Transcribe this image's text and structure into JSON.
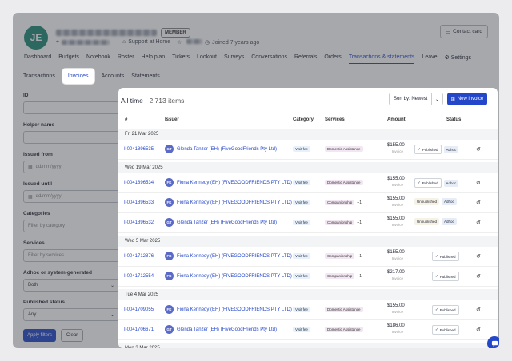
{
  "profile": {
    "initials": "JE",
    "member_badge": "MEMBER",
    "meta_support": "Support at Home",
    "meta_joined": "Joined 7 years ago",
    "contact_label": "Contact card"
  },
  "nav": [
    "Dashboard",
    "Budgets",
    "Notebook",
    "Roster",
    "Help plan",
    "Tickets",
    "Lookout",
    "Surveys",
    "Conversations",
    "Referrals",
    "Orders",
    "Transactions & statements",
    "Leave",
    "Settings"
  ],
  "subtabs": [
    "Transactions",
    "Invoices",
    "Accounts",
    "Statements"
  ],
  "filters": {
    "id_label": "ID",
    "helper_label": "Helper name",
    "issued_from_label": "Issued from",
    "issued_from_placeholder": "dd/mm/yyyy",
    "issued_until_label": "Issued until",
    "issued_until_placeholder": "dd/mm/yyyy",
    "categories_label": "Categories",
    "categories_placeholder": "Filter by category",
    "services_label": "Services",
    "services_placeholder": "Filter by services",
    "adhoc_label": "Adhoc or system-generated",
    "adhoc_value": "Both",
    "published_label": "Published status",
    "published_value": "Any",
    "apply_label": "Apply filters",
    "clear_label": "Clear"
  },
  "invoices": {
    "title": "All time",
    "count": "2,713 items",
    "sort_label": "Sort by: Newest",
    "new_label": "New invoice",
    "columns": [
      "#",
      "Issuer",
      "Category",
      "Services",
      "Amount",
      "Status"
    ],
    "groups": [
      {
        "date": "Fri 21 Mar 2025",
        "rows": [
          {
            "id": "I-0041896535",
            "initials": "GT",
            "issuer": "Glenda Tanzer (EH) (FiveGoodFriends Pty Ltd)",
            "category": "Visit fee",
            "service": "Domestic Assistance",
            "more": "",
            "amount": "$155.00",
            "amount_sub": "Invoice",
            "status": "Published",
            "adhoc": "Adhoc"
          }
        ]
      },
      {
        "date": "Wed 19 Mar 2025",
        "rows": [
          {
            "id": "I-0041896534",
            "initials": "FK",
            "issuer": "Fiona Kennedy (EH) (FIVEGOODFRIENDS PTY LTD)",
            "category": "Visit fee",
            "service": "Domestic Assistance",
            "more": "",
            "amount": "$155.00",
            "amount_sub": "Invoice",
            "status": "Published",
            "adhoc": "Adhoc"
          },
          {
            "id": "I-0041896533",
            "initials": "FK",
            "issuer": "Fiona Kennedy (EH) (FIVEGOODFRIENDS PTY LTD)",
            "category": "Visit fee",
            "service": "Companionship",
            "more": "+1",
            "amount": "$155.00",
            "amount_sub": "Invoice",
            "status": "Unpublished",
            "adhoc": "Adhoc"
          },
          {
            "id": "I-0041896532",
            "initials": "GT",
            "issuer": "Glenda Tanzer (EH) (FiveGoodFriends Pty Ltd)",
            "category": "Visit fee",
            "service": "Companionship",
            "more": "+1",
            "amount": "$155.00",
            "amount_sub": "Invoice",
            "status": "Unpublished",
            "adhoc": "Adhoc"
          }
        ]
      },
      {
        "date": "Wed 5 Mar 2025",
        "rows": [
          {
            "id": "I-0041712876",
            "initials": "FK",
            "issuer": "Fiona Kennedy (EH) (FIVEGOODFRIENDS PTY LTD)",
            "category": "Visit fee",
            "service": "Companionship",
            "more": "+1",
            "amount": "$155.00",
            "amount_sub": "Invoice",
            "status": "Published",
            "adhoc": ""
          },
          {
            "id": "I-0041712554",
            "initials": "FK",
            "issuer": "Fiona Kennedy (EH) (FIVEGOODFRIENDS PTY LTD)",
            "category": "Visit fee",
            "service": "Companionship",
            "more": "+1",
            "amount": "$217.00",
            "amount_sub": "Invoice",
            "status": "Published",
            "adhoc": ""
          }
        ]
      },
      {
        "date": "Tue 4 Mar 2025",
        "rows": [
          {
            "id": "I-0041709055",
            "initials": "FK",
            "issuer": "Fiona Kennedy (EH) (FIVEGOODFRIENDS PTY LTD)",
            "category": "Visit fee",
            "service": "Domestic Assistance",
            "more": "",
            "amount": "$155.00",
            "amount_sub": "Invoice",
            "status": "Published",
            "adhoc": ""
          },
          {
            "id": "I-0041706671",
            "initials": "GT",
            "issuer": "Glenda Tanzer (EH) (FiveGoodFriends Pty Ltd)",
            "category": "Visit fee",
            "service": "Domestic Assistance",
            "more": "",
            "amount": "$186.00",
            "amount_sub": "Invoice",
            "status": "Published",
            "adhoc": ""
          }
        ]
      },
      {
        "date": "Mon 3 Mar 2025",
        "rows": []
      }
    ]
  }
}
